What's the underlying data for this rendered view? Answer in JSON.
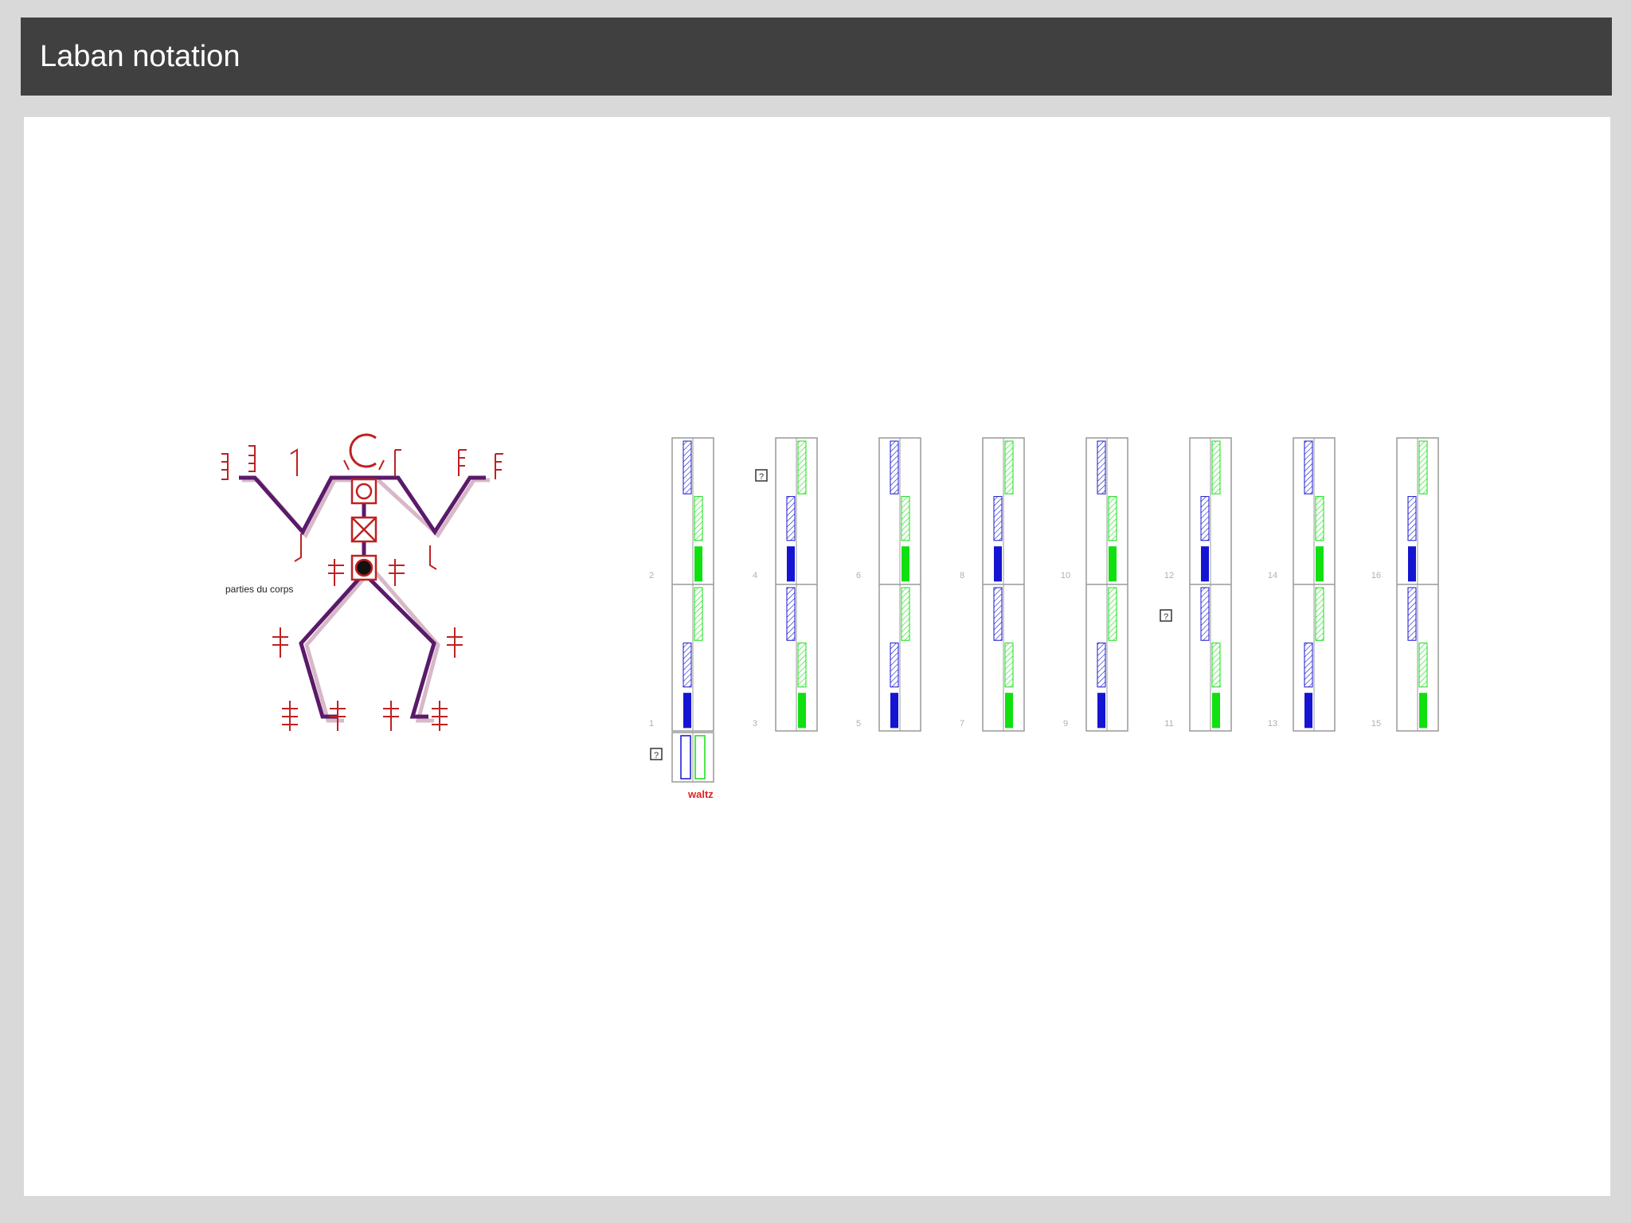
{
  "slide": {
    "title": "Laban notation"
  },
  "figure": {
    "body_parts_caption": "parties du corps",
    "waltz_label": "waltz",
    "question_marker": "?",
    "colors": {
      "left_side": "#1414d2",
      "right_side": "#10e010",
      "body_figure": "#5a1a6a",
      "symbols": "#c02020",
      "staff_line": "#999999",
      "waltz_label": "#e02020"
    },
    "measure_numbers": [
      {
        "upper": "2",
        "lower": "1"
      },
      {
        "upper": "4",
        "lower": "3"
      },
      {
        "upper": "6",
        "lower": "5"
      },
      {
        "upper": "8",
        "lower": "7"
      },
      {
        "upper": "10",
        "lower": "9"
      },
      {
        "upper": "12",
        "lower": "11"
      },
      {
        "upper": "14",
        "lower": "13"
      },
      {
        "upper": "16",
        "lower": "15"
      }
    ]
  }
}
